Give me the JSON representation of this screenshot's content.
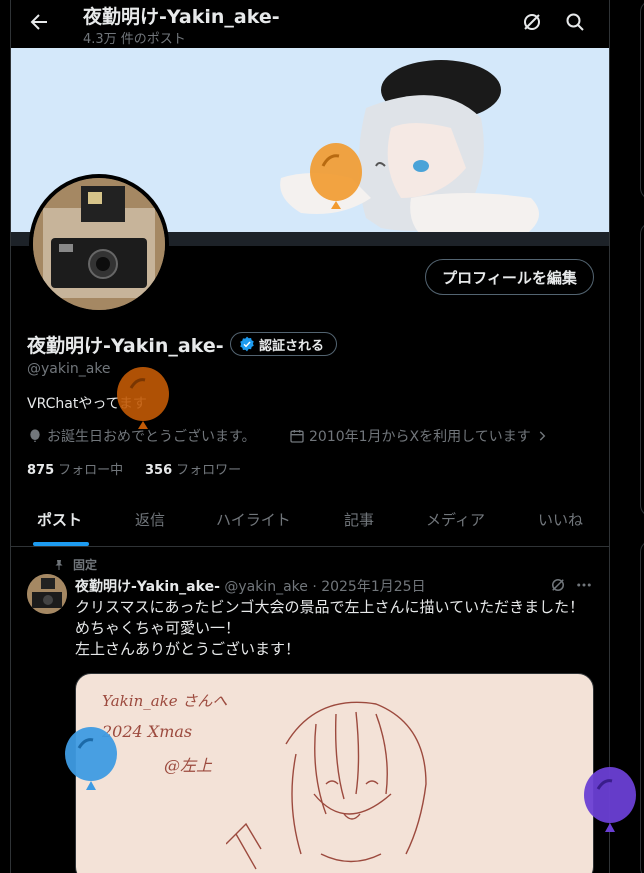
{
  "header": {
    "title": "夜勤明け-Yakin_ake-",
    "post_count": "4.3万 件のポスト"
  },
  "profile": {
    "edit_label": "プロフィールを編集",
    "name": "夜勤明け-Yakin_ake-",
    "verify_label": "認証される",
    "handle": "@yakin_ake",
    "bio": "VRChatやってます",
    "birthday": "お誕生日おめでとうございます。",
    "joined": "2010年1月からXを利用しています",
    "following_count": "875",
    "following_label": "フォロー中",
    "followers_count": "356",
    "followers_label": "フォロワー"
  },
  "tabs": [
    "ポスト",
    "返信",
    "ハイライト",
    "記事",
    "メディア",
    "いいね"
  ],
  "post": {
    "pinned_label": "固定",
    "author": "夜勤明け-Yakin_ake-",
    "meta": "@yakin_ake · 2025年1月25日",
    "lines": [
      "クリスマスにあったビンゴ大会の景品で左上さんに描いていただきました！",
      "めちゃくちゃ可愛い一！",
      "左上さんありがとうございます！"
    ],
    "image_text": {
      "line1": "Yakin_ake さんへ",
      "line2": "2024 Xmas",
      "line3": "@左上"
    }
  },
  "colors": {
    "accent": "#1d9bf0",
    "balloon_orange": "#f29a2e",
    "balloon_dark_orange": "#c25a06",
    "balloon_blue": "#3e9be3",
    "balloon_purple": "#6a3fd4"
  }
}
